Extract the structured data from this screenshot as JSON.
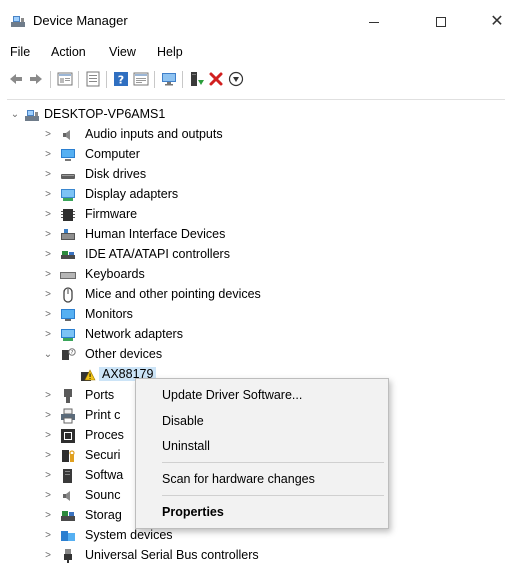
{
  "window": {
    "title": "Device Manager",
    "minimize_label": "—",
    "close_label": "✕"
  },
  "menu": [
    "File",
    "Action",
    "View",
    "Help"
  ],
  "tree": {
    "root": "DESKTOP-VP6AMS1",
    "items": [
      "Audio inputs and outputs",
      "Computer",
      "Disk drives",
      "Display adapters",
      "Firmware",
      "Human Interface Devices",
      "IDE ATA/ATAPI controllers",
      "Keyboards",
      "Mice and other pointing devices",
      "Monitors",
      "Network adapters",
      "Other devices"
    ],
    "other_device_child": "AX88179",
    "items_after": [
      "Ports",
      "Print c",
      "Proces",
      "Securi",
      "Softwa",
      "Sounc",
      "Storag",
      "System devices",
      "Universal Serial Bus controllers"
    ]
  },
  "context_menu": {
    "update": "Update Driver Software...",
    "disable": "Disable",
    "uninstall": "Uninstall",
    "scan": "Scan for hardware changes",
    "properties": "Properties"
  },
  "colors": {
    "selection": "#cce4f7",
    "remove_x": "#d11f1f",
    "warning": "#f0c419"
  }
}
